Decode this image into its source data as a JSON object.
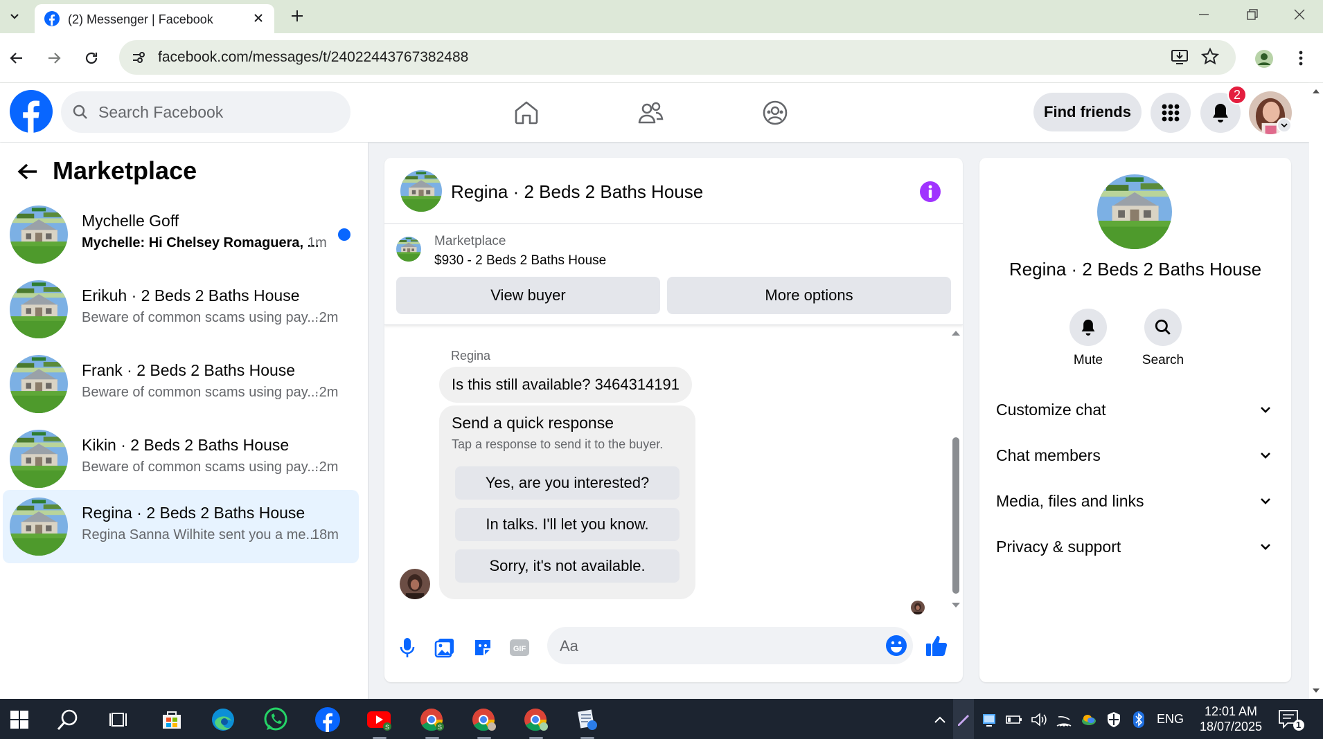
{
  "browser": {
    "tab_title": "(2) Messenger | Facebook",
    "url": "facebook.com/messages/t/24022443767382488"
  },
  "facebook": {
    "search_placeholder": "Search Facebook",
    "find_friends": "Find friends",
    "notifications_count": "2"
  },
  "sidebar": {
    "title": "Marketplace",
    "chats": [
      {
        "name": "Mychelle Goff",
        "preview": "Mychelle: Hi Chelsey Romaguera, ...",
        "time": "1m",
        "unread": true
      },
      {
        "name": "Erikuh · 2 Beds 2 Baths House",
        "preview": "Beware of common scams using pay...",
        "time": "·2m",
        "unread": false
      },
      {
        "name": "Frank · 2 Beds 2 Baths House",
        "preview": "Beware of common scams using pay...",
        "time": "·2m",
        "unread": false
      },
      {
        "name": "Kikin · 2 Beds 2 Baths House",
        "preview": "Beware of common scams using pay...",
        "time": "·2m",
        "unread": false
      },
      {
        "name": "Regina · 2 Beds 2 Baths House",
        "preview": "Regina Sanna Wilhite sent you a me...",
        "time": "18m",
        "unread": false,
        "selected": true
      }
    ]
  },
  "conversation": {
    "title": "Regina · 2 Beds 2 Baths House",
    "listing_label": "Marketplace",
    "listing_title": "$930 - 2 Beds 2 Baths House",
    "view_buyer": "View buyer",
    "more_options": "More options",
    "sender": "Regina",
    "message": "Is this still available? 3464314191",
    "quick_title": "Send a quick response",
    "quick_sub": "Tap a response to send it to the buyer.",
    "quick_responses": [
      "Yes, are you interested?",
      "In talks. I'll let you know.",
      "Sorry, it's not available."
    ],
    "composer_placeholder": "Aa"
  },
  "info_panel": {
    "name": "Regina · 2 Beds 2 Baths House",
    "mute": "Mute",
    "search": "Search",
    "sections": [
      "Customize chat",
      "Chat members",
      "Media, files and links",
      "Privacy & support"
    ]
  },
  "taskbar": {
    "lang": "ENG",
    "time": "12:01 AM",
    "date": "18/07/2025",
    "notif_count": "1"
  },
  "colors": {
    "facebook_blue": "#0866ff",
    "messenger_purple": "#a033ff",
    "selected_chat_bg": "#e7f3ff",
    "badge_red": "#e41e3f",
    "taskbar_bg": "#1c2430"
  }
}
